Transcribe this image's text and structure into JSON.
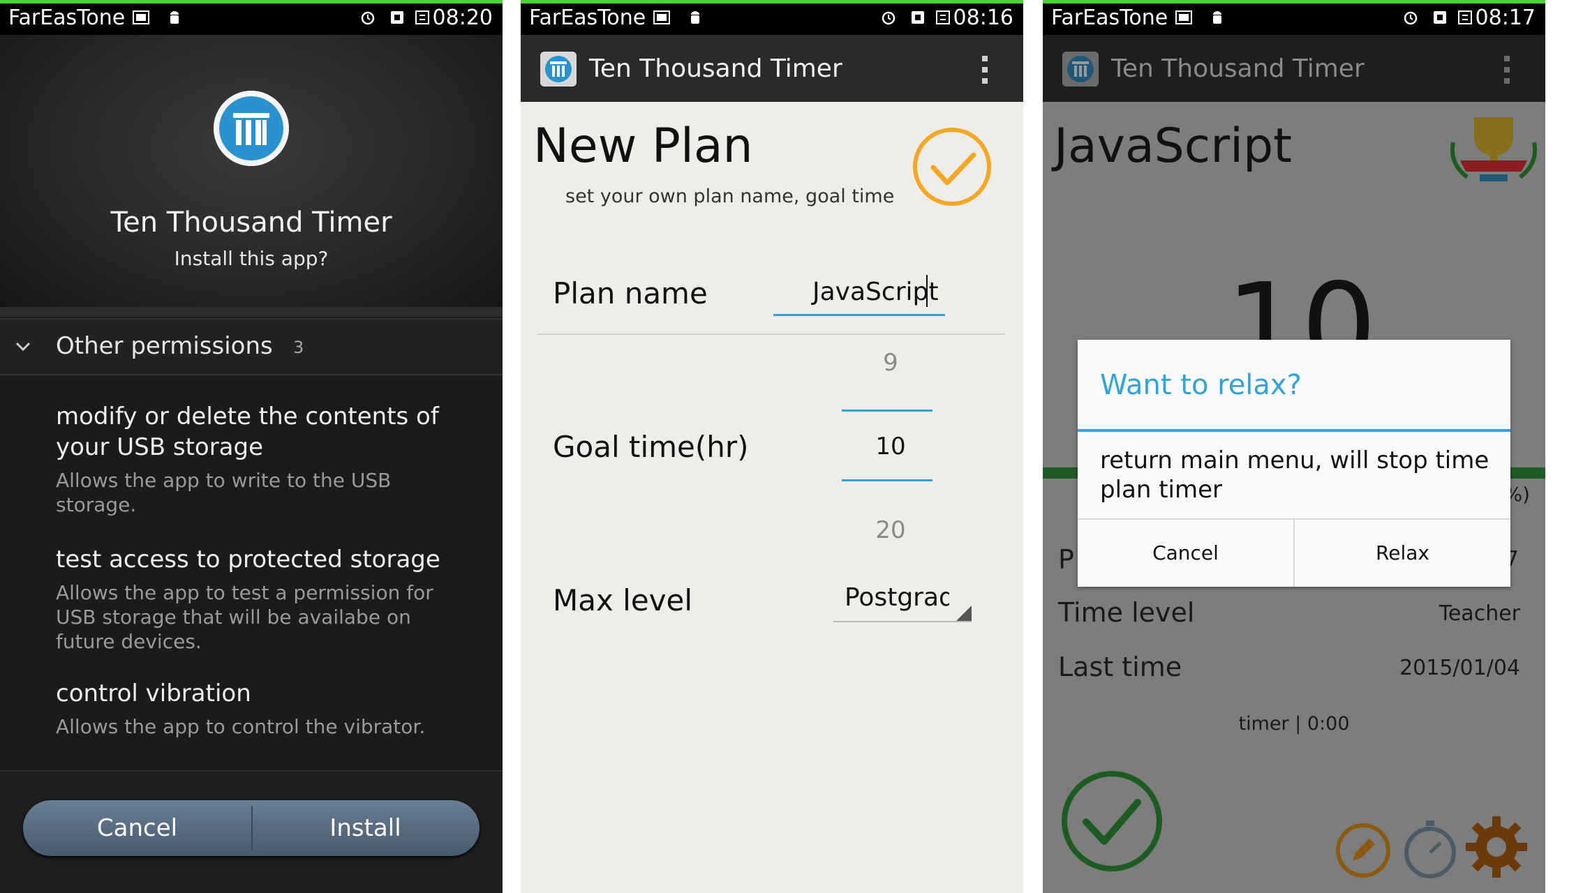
{
  "status": {
    "carrier": "FarEasTone",
    "times": [
      "08:20",
      "08:16",
      "08:17"
    ]
  },
  "install": {
    "app_name": "Ten Thousand Timer",
    "prompt": "Install this app?",
    "section_label": "Other permissions",
    "section_count": "3",
    "permissions": [
      {
        "title": "modify or delete the contents of your USB storage",
        "desc": "Allows the app to write to the USB storage."
      },
      {
        "title": "test access to protected storage",
        "desc": "Allows the app to test a permission for USB storage that will be availabe on future devices."
      },
      {
        "title": "control vibration",
        "desc": "Allows the app to control the vibrator."
      }
    ],
    "cancel_label": "Cancel",
    "install_label": "Install"
  },
  "app_bar": {
    "title": "Ten Thousand Timer"
  },
  "new_plan": {
    "heading": "New Plan",
    "subtitle": "set your own plan name, goal time",
    "plan_name_label": "Plan name",
    "plan_name_value": "JavaScript",
    "goal_label": "Goal time(hr)",
    "goal_prev": "9",
    "goal_value": "10",
    "goal_next": "20",
    "max_level_label": "Max level",
    "max_level_value": "Postgraduate"
  },
  "plan_detail": {
    "heading": "JavaScript",
    "big_number": "10",
    "percent_fragment": "%)",
    "p_fragment": "P",
    "seven_fragment": "7",
    "time_level_label": "Time level",
    "time_level_value": "Teacher",
    "last_time_label": "Last time",
    "last_time_value": "2015/01/04",
    "timer_text": "timer | 0:00"
  },
  "dialog": {
    "title": "Want to relax?",
    "message": "return main menu, will stop time plan timer",
    "cancel_label": "Cancel",
    "relax_label": "Relax"
  },
  "colors": {
    "accent_blue": "#33a3d6",
    "check_orange": "#f5a623",
    "check_green": "#1e5b22",
    "pill_blue": "#5a6e84"
  },
  "icons": [
    "picture-icon",
    "android-icon",
    "alarm-icon",
    "sim-icon",
    "sync-icon",
    "chevron-down-icon",
    "checkmark-icon",
    "trophy-icon",
    "edit-icon",
    "stopwatch-icon",
    "settings-gear-icon",
    "overflow-menu-icon",
    "app-logo-icon"
  ]
}
